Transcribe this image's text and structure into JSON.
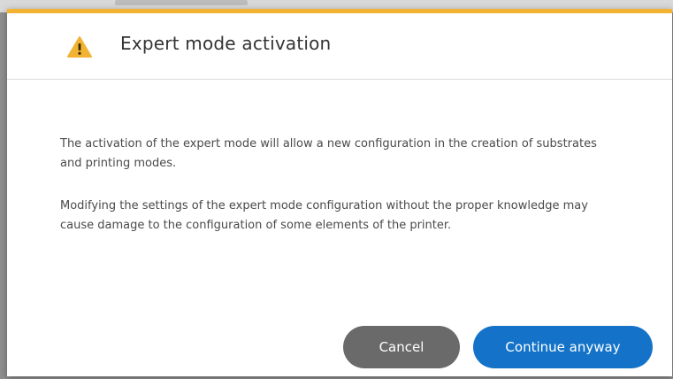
{
  "dialog": {
    "title": "Expert mode activation",
    "icon": "warning-icon",
    "accent_color": "#f2b233",
    "paragraph1": "The activation of the expert mode will allow a new configuration in the creation of substrates and printing modes.",
    "paragraph2": "Modifying the settings of the expert mode configuration without the proper knowledge may cause damage to the configuration of some elements of the printer.",
    "cancel_label": "Cancel",
    "continue_label": "Continue anyway",
    "cancel_color": "#6a6a6a",
    "continue_color": "#1473c8"
  }
}
